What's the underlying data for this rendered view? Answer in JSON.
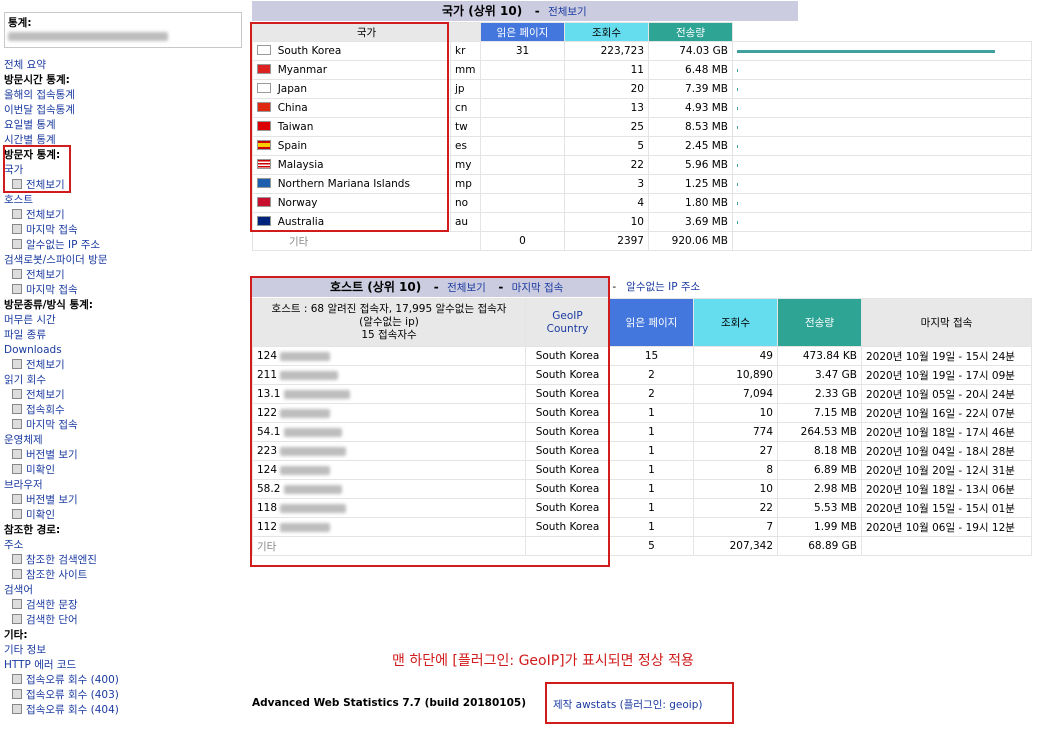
{
  "sidebar": {
    "stat_label": "통계:",
    "nav": [
      {
        "t": "link",
        "text": "전체 요약"
      },
      {
        "t": "head",
        "text": "방문시간 통계:"
      },
      {
        "t": "link",
        "text": "올해의 접속통계"
      },
      {
        "t": "link",
        "text": "이번달 접속통계"
      },
      {
        "t": "link",
        "text": "요일별 통계"
      },
      {
        "t": "link",
        "text": "시간별 통계"
      },
      {
        "t": "head",
        "text": "방문자 통계:"
      },
      {
        "t": "link",
        "text": "국가"
      },
      {
        "t": "sub",
        "text": "전체보기"
      },
      {
        "t": "link",
        "text": "호스트"
      },
      {
        "t": "sub",
        "text": "전체보기"
      },
      {
        "t": "sub",
        "text": "마지막 접속"
      },
      {
        "t": "sub",
        "text": "알수없는 IP 주소"
      },
      {
        "t": "link",
        "text": "검색로봇/스파이더 방문"
      },
      {
        "t": "sub",
        "text": "전체보기"
      },
      {
        "t": "sub",
        "text": "마지막 접속"
      },
      {
        "t": "head",
        "text": "방문종류/방식 통계:"
      },
      {
        "t": "link",
        "text": "머무른 시간"
      },
      {
        "t": "link",
        "text": "파일 종류"
      },
      {
        "t": "link",
        "text": "Downloads"
      },
      {
        "t": "sub",
        "text": "전체보기"
      },
      {
        "t": "link",
        "text": "읽기 회수"
      },
      {
        "t": "sub",
        "text": "전체보기"
      },
      {
        "t": "sub",
        "text": "접속회수"
      },
      {
        "t": "sub",
        "text": "마지막 접속"
      },
      {
        "t": "link",
        "text": "운영체제"
      },
      {
        "t": "sub",
        "text": "버전별 보기"
      },
      {
        "t": "sub",
        "text": "미확인"
      },
      {
        "t": "link",
        "text": "브라우저"
      },
      {
        "t": "sub",
        "text": "버전별 보기"
      },
      {
        "t": "sub",
        "text": "미확인"
      },
      {
        "t": "head",
        "text": "참조한 경로:"
      },
      {
        "t": "link",
        "text": "주소"
      },
      {
        "t": "sub",
        "text": "참조한 검색엔진"
      },
      {
        "t": "sub",
        "text": "참조한 사이트"
      },
      {
        "t": "link",
        "text": "검색어"
      },
      {
        "t": "sub",
        "text": "검색한 문장"
      },
      {
        "t": "sub",
        "text": "검색한 단어"
      },
      {
        "t": "head",
        "text": "기타:"
      },
      {
        "t": "link",
        "text": "기타 정보"
      },
      {
        "t": "link",
        "text": "HTTP 에러 코드"
      },
      {
        "t": "sub",
        "text": "접속오류 회수 (400)"
      },
      {
        "t": "sub",
        "text": "접속오류 회수 (403)"
      },
      {
        "t": "sub",
        "text": "접속오류 회수 (404)"
      }
    ]
  },
  "country": {
    "title": "국가 (상위 10)",
    "view_all": "전체보기",
    "headers": {
      "country": "국가",
      "pages": "읽은 페이지",
      "hits": "조회수",
      "bandwidth": "전송량"
    },
    "colors": {
      "pages": "#4477dd",
      "hits": "#66ddee",
      "bandwidth": "#2ea495",
      "bar": "#40a0a0"
    },
    "rows": [
      {
        "flag": "kr-flag-icon",
        "name": "South Korea",
        "code": "kr",
        "pages": "31",
        "hits": "223,723",
        "bw": "74.03 GB",
        "bar_frac": 1.0
      },
      {
        "flag": "mm-flag-icon",
        "name": "Myanmar",
        "code": "mm",
        "pages": "",
        "hits": "11",
        "bw": "6.48 MB",
        "bar_frac": 0.0
      },
      {
        "flag": "jp-flag-icon",
        "name": "Japan",
        "code": "jp",
        "pages": "",
        "hits": "20",
        "bw": "7.39 MB",
        "bar_frac": 0.0
      },
      {
        "flag": "cn-flag-icon",
        "name": "China",
        "code": "cn",
        "pages": "",
        "hits": "13",
        "bw": "4.93 MB",
        "bar_frac": 0.0
      },
      {
        "flag": "tw-flag-icon",
        "name": "Taiwan",
        "code": "tw",
        "pages": "",
        "hits": "25",
        "bw": "8.53 MB",
        "bar_frac": 0.0
      },
      {
        "flag": "es-flag-icon",
        "name": "Spain",
        "code": "es",
        "pages": "",
        "hits": "5",
        "bw": "2.45 MB",
        "bar_frac": 0.0
      },
      {
        "flag": "my-flag-icon",
        "name": "Malaysia",
        "code": "my",
        "pages": "",
        "hits": "22",
        "bw": "5.96 MB",
        "bar_frac": 0.0
      },
      {
        "flag": "mp-flag-icon",
        "name": "Northern Mariana Islands",
        "code": "mp",
        "pages": "",
        "hits": "3",
        "bw": "1.25 MB",
        "bar_frac": 0.0
      },
      {
        "flag": "no-flag-icon",
        "name": "Norway",
        "code": "no",
        "pages": "",
        "hits": "4",
        "bw": "1.80 MB",
        "bar_frac": 0.0
      },
      {
        "flag": "au-flag-icon",
        "name": "Australia",
        "code": "au",
        "pages": "",
        "hits": "10",
        "bw": "3.69 MB",
        "bar_frac": 0.0
      }
    ],
    "other": {
      "label": "기타",
      "pages": "0",
      "hits": "2397",
      "bw": "920.06 MB"
    }
  },
  "hosts": {
    "title": "호스트 (상위 10)",
    "links": [
      "전체보기",
      "마지막 접속",
      "알수없는 IP 주소"
    ],
    "sep": "-",
    "summary_line1": "호스트 : 68 알려진 접속자, 17,995 알수없는 접속자",
    "summary_line2": "(알수없는 ip)",
    "summary_line3": "15 접속자수",
    "geoip_header": "GeoIP Country",
    "headers": {
      "pages": "읽은 페이지",
      "hits": "조회수",
      "bandwidth": "전송량",
      "last": "마지막 접속"
    },
    "rows": [
      {
        "ip": "124",
        "country": "South Korea",
        "pages": "15",
        "hits": "49",
        "bw": "473.84 KB",
        "last": "2020년 10월 19일 - 15시 24분"
      },
      {
        "ip": "211",
        "country": "South Korea",
        "pages": "2",
        "hits": "10,890",
        "bw": "3.47 GB",
        "last": "2020년 10월 19일 - 17시 09분"
      },
      {
        "ip": "13.1",
        "country": "South Korea",
        "pages": "2",
        "hits": "7,094",
        "bw": "2.33 GB",
        "last": "2020년 10월 05일 - 20시 24분"
      },
      {
        "ip": "122",
        "country": "South Korea",
        "pages": "1",
        "hits": "10",
        "bw": "7.15 MB",
        "last": "2020년 10월 16일 - 22시 07분"
      },
      {
        "ip": "54.1",
        "country": "South Korea",
        "pages": "1",
        "hits": "774",
        "bw": "264.53 MB",
        "last": "2020년 10월 18일 - 17시 46분"
      },
      {
        "ip": "223",
        "country": "South Korea",
        "pages": "1",
        "hits": "27",
        "bw": "8.18 MB",
        "last": "2020년 10월 04일 - 18시 28분"
      },
      {
        "ip": "124",
        "country": "South Korea",
        "pages": "1",
        "hits": "8",
        "bw": "6.89 MB",
        "last": "2020년 10월 20일 - 12시 31분"
      },
      {
        "ip": "58.2",
        "country": "South Korea",
        "pages": "1",
        "hits": "10",
        "bw": "2.98 MB",
        "last": "2020년 10월 18일 - 13시 06분"
      },
      {
        "ip": "118",
        "country": "South Korea",
        "pages": "1",
        "hits": "22",
        "bw": "5.53 MB",
        "last": "2020년 10월 15일 - 15시 01분"
      },
      {
        "ip": "112",
        "country": "South Korea",
        "pages": "1",
        "hits": "7",
        "bw": "1.99 MB",
        "last": "2020년 10월 06일 - 19시 12분"
      }
    ],
    "other": {
      "label": "기타",
      "pages": "5",
      "hits": "207,342",
      "bw": "68.89 GB"
    }
  },
  "annotation": "맨 하단에 [플러그인: GeoIP]가 표시되면 정상 적용",
  "footer": {
    "product": "Advanced Web Statistics 7.7 (build 20180105)",
    "credit": "제작 awstats (플러그인: geoip)"
  },
  "accent_red": "#d01c1c"
}
